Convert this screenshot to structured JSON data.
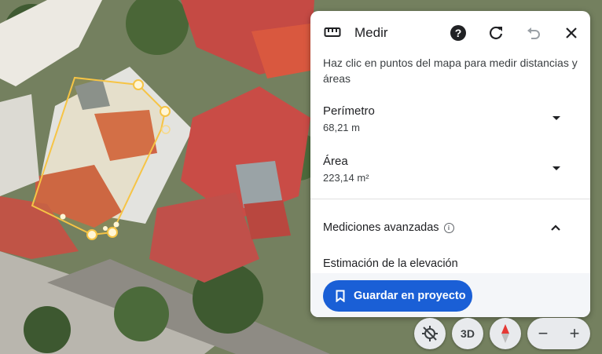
{
  "panel": {
    "title": "Medir",
    "instructions": "Haz clic en puntos del mapa para medir distancias y áreas",
    "perimeter": {
      "label": "Perímetro",
      "value": "68,21 m"
    },
    "area": {
      "label": "Área",
      "value": "223,14 m²"
    },
    "advanced": {
      "label": "Mediciones avanzadas",
      "info_icon": "ⓘ"
    },
    "elevation": {
      "label": "Estimación de la elevación"
    },
    "save_label": "Guardar en proyecto",
    "header_icons": [
      "ruler-icon",
      "help-icon",
      "refresh-icon",
      "undo-icon",
      "close-icon"
    ]
  },
  "map_controls": {
    "btn_3d": "3D",
    "zoom_out": "−",
    "zoom_in": "+"
  },
  "colors": {
    "accent": "#1a5fd6",
    "measure_line": "#f6c445",
    "panel_bg": "#ffffff"
  }
}
